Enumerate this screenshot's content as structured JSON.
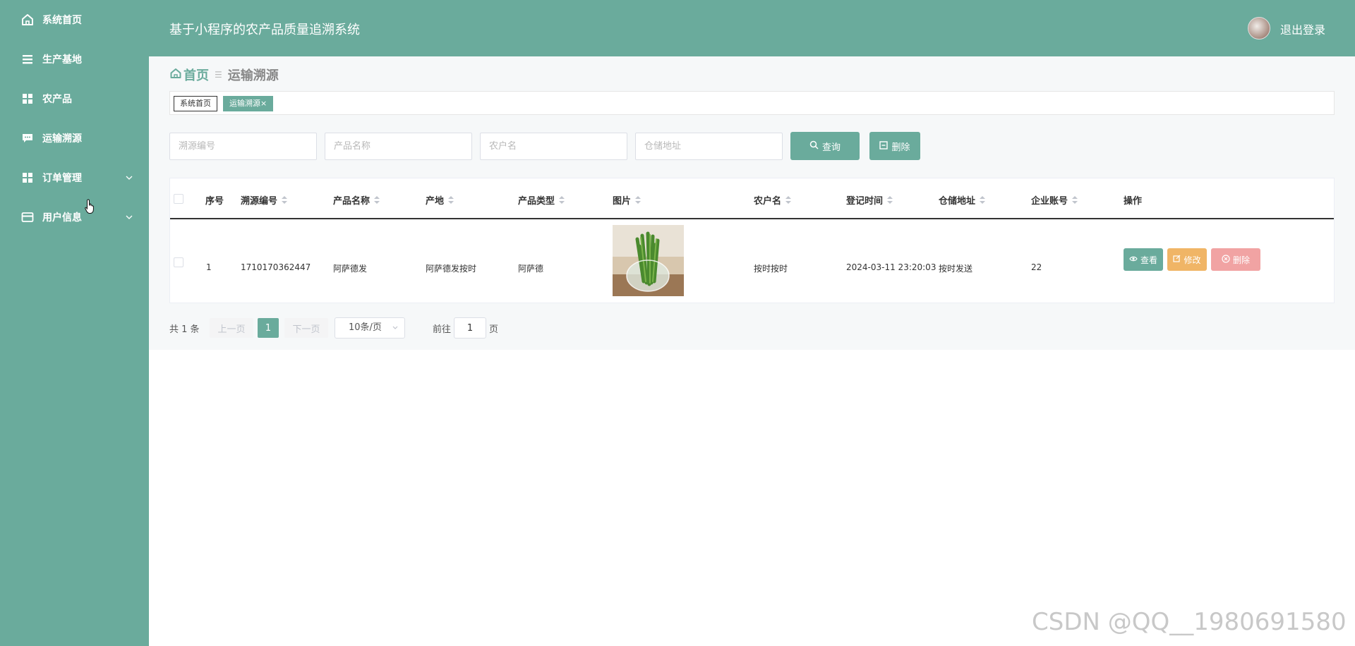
{
  "header": {
    "title": "基于小程序的农产品质量追溯系统",
    "logout_label": "退出登录"
  },
  "sidebar": {
    "items": [
      {
        "label": "系统首页",
        "icon": "home-icon"
      },
      {
        "label": "生产基地",
        "icon": "list-icon"
      },
      {
        "label": "农产品",
        "icon": "grid-icon"
      },
      {
        "label": "运输溯源",
        "icon": "message-icon"
      },
      {
        "label": "订单管理",
        "icon": "grid-icon",
        "expandable": true
      },
      {
        "label": "用户信息",
        "icon": "card-icon",
        "expandable": true
      }
    ]
  },
  "breadcrumb": {
    "home": "首页",
    "current": "运输溯源"
  },
  "tags": [
    {
      "label": "系统首页",
      "active": false
    },
    {
      "label": "运输溯源",
      "active": true,
      "close": "×"
    }
  ],
  "search": {
    "trace_no_placeholder": "溯源编号",
    "product_name_placeholder": "产品名称",
    "farmer_name_placeholder": "农户名",
    "warehouse_placeholder": "仓储地址",
    "query_label": "查询",
    "delete_label": "删除"
  },
  "table": {
    "columns": [
      "序号",
      "溯源编号",
      "产品名称",
      "产地",
      "产品类型",
      "图片",
      "农户名",
      "登记时间",
      "仓储地址",
      "企业账号",
      "操作"
    ],
    "rows": [
      {
        "index": "1",
        "trace_no": "1710170362447",
        "product_name": "阿萨德发",
        "origin": "阿萨德发按时",
        "product_type": "阿萨德",
        "farmer_name": "按时按时",
        "register_time": "2024-03-11 23:20:03",
        "warehouse": "按时发送",
        "company_account": "22",
        "view_label": "查看",
        "edit_label": "修改",
        "delete_label": "删除"
      }
    ]
  },
  "pagination": {
    "total": "共 1 条",
    "prev": "上一页",
    "current_page": "1",
    "next": "下一页",
    "page_size": "10条/页",
    "goto_prefix": "前往",
    "goto_value": "1",
    "goto_suffix": "页"
  },
  "watermark": "CSDN @QQ__1980691580",
  "colors": {
    "primary": "#6aab9c",
    "warning": "#f0b566",
    "danger": "#f1a3a3"
  }
}
